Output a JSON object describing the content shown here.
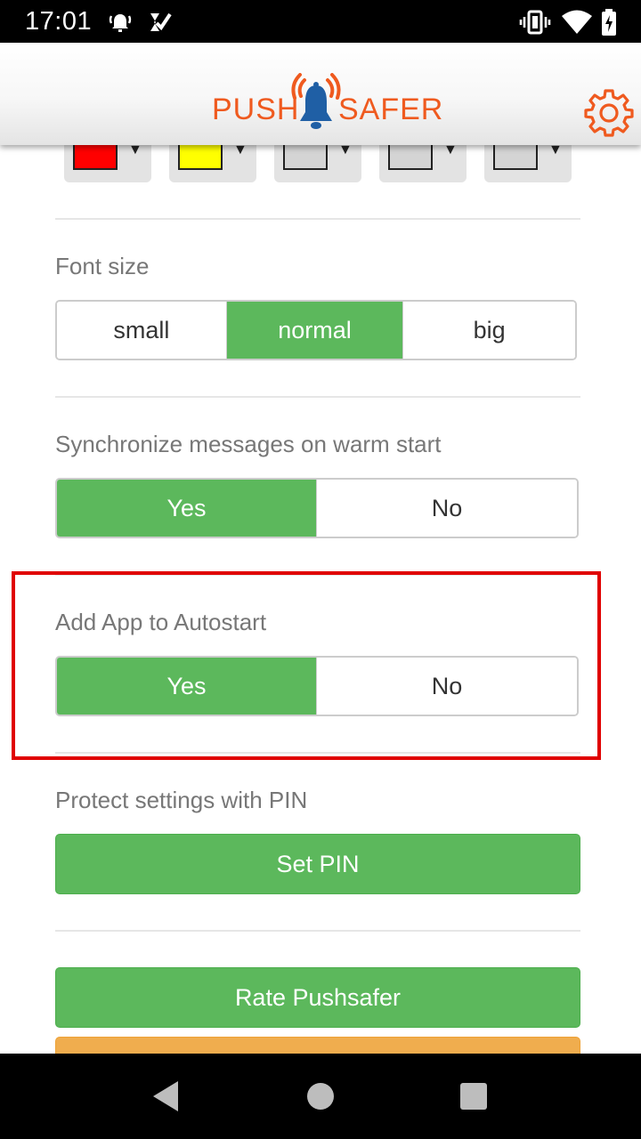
{
  "status_bar": {
    "time": "17:01",
    "left_icons": [
      "alarm-icon",
      "check-notification-icon"
    ],
    "right_icons": [
      "vibrate-icon",
      "wifi-icon",
      "battery-charging-icon"
    ]
  },
  "header": {
    "logo_word_1": "PUSH",
    "logo_word_2": "SAFER",
    "logo_icon": "bell-icon",
    "settings_icon": "gear-icon",
    "brand_color": "#ef5a1f"
  },
  "colors": {
    "accent_green": "#5cb85c",
    "highlight_red": "#e00000",
    "button_orange": "#f0ad4e"
  },
  "color_pickers": [
    {
      "color": "#ff0000"
    },
    {
      "color": "#ffff00"
    },
    {
      "color": "#d4d4d4"
    },
    {
      "color": "#d4d4d4"
    },
    {
      "color": "#d4d4d4"
    }
  ],
  "font_size": {
    "label": "Font size",
    "options": [
      "small",
      "normal",
      "big"
    ],
    "selected": "normal"
  },
  "sync": {
    "label": "Synchronize messages on warm start",
    "yes": "Yes",
    "no": "No",
    "selected": "Yes"
  },
  "autostart": {
    "label": "Add App to Autostart",
    "yes": "Yes",
    "no": "No",
    "selected": "Yes"
  },
  "pin": {
    "label": "Protect settings with PIN",
    "button": "Set PIN"
  },
  "rate": {
    "button": "Rate Pushsafer"
  },
  "nav": {
    "back_icon": "back-icon",
    "home_icon": "home-icon",
    "recents_icon": "recents-icon"
  }
}
